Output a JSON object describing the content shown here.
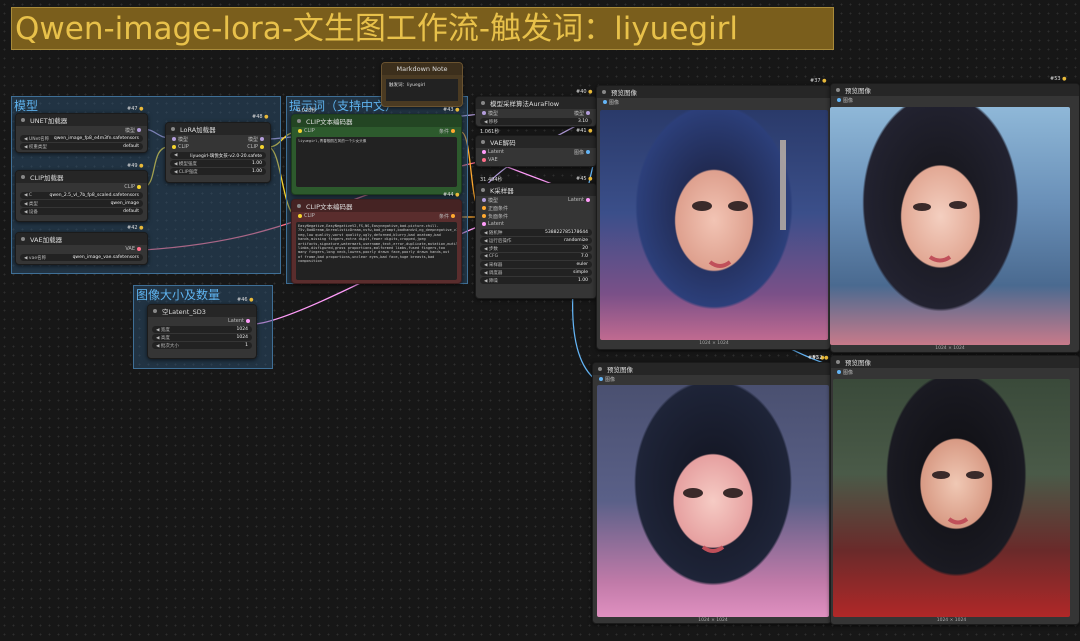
{
  "title": "Qwen-image-lora-文生图工作流-触发词：liyuegirl",
  "groups": {
    "model": "模型",
    "prompt": "提示词（支持中文）",
    "image_size": "图像大小及数量"
  },
  "markdown_note": {
    "title": "Markdown Note",
    "text": "触发词：liyuegirl"
  },
  "unet": {
    "title": "UNET加载器",
    "badge": "#47",
    "out": "模型",
    "unet_label": "UNet名称",
    "unet_value": "qwen_image_fp8_e4m3fn.safetensors",
    "dtype_label": "权重类型",
    "dtype_value": "default"
  },
  "clip_loader": {
    "title": "CLIP加载器",
    "badge": "#49",
    "out": "CLIP",
    "clip_label": "C",
    "clip_value": "qwen_2.5_vl_7b_fp8_scaled.safetensors",
    "type_label": "类型",
    "type_value": "qwen_image",
    "device_label": "设备",
    "device_value": "default"
  },
  "vae_loader": {
    "title": "VAE加载器",
    "badge": "#42",
    "out": "VAE",
    "vae_label": "vae名称",
    "vae_value": "qwen_image_vae.safetensors"
  },
  "lora": {
    "title": "LoRA加载器",
    "badge": "#48",
    "in_model": "模型",
    "in_clip": "CLIP",
    "out_model": "模型",
    "out_clip": "CLIP",
    "lora_value": "liyuegirl-璃悦女孩-v2.0-20.safete",
    "model_strength_label": "模型强度",
    "model_strength": "1.00",
    "clip_strength_label": "CLIP强度",
    "clip_strength": "1.00"
  },
  "clip_pos": {
    "title": "CLIP文本编码器",
    "badge": "#43",
    "time": "0.028秒",
    "in": "CLIP",
    "out": "条件",
    "text": "liyuegirl,青春靓丽古风的一个少女头像"
  },
  "clip_neg": {
    "title": "CLIP文本编码器",
    "badge": "#44",
    "in": "CLIP",
    "out": "条件",
    "text": "EasyNegative,EasyNegativeV2,FS,NS,Easynegative,bad-picture-chill-75v,BadDream,UnrealisticDream,nsfw,bad_prompt,badhandv4,ng_deepnegative_v1_75t,verybadimagenegative_v1.3,badhandv4,bad_prompt_version2,negative_hand-neg,low quality,worst quality,ugly,deformed,blurry,bad anatomy,bad hands,missing fingers,extra digit,fewer digits,cropped,jpeg artifacts,signature,watermark,username,text,error,duplicate,mutation,mutilated,extra limbs,disfigured,gross proportions,malformed limbs,fused fingers,too many fingers,long neck,lowres,poorly drawn face,poorly drawn hands,out of frame,bad proportions,unclear eyes,bad face,huge breasts,bad composition"
  },
  "aura": {
    "title": "模型采样算法AuraFlow",
    "badge": "#40",
    "in": "模型",
    "out": "模型",
    "shift_label": "移移",
    "shift_value": "3.10"
  },
  "vae_decode": {
    "title": "VAE解码",
    "badge": "#41",
    "time": "1.061秒",
    "in_latent": "Latent",
    "in_vae": "VAE",
    "out": "图像"
  },
  "ksampler": {
    "title": "K采样器",
    "badge": "#45",
    "time": "31.494秒",
    "in_model": "模型",
    "in_pos": "正面条件",
    "in_neg": "负面条件",
    "in_latent": "Latent",
    "out": "Latent",
    "seed_label": "随机种",
    "seed_value": "538822785178644",
    "control_label": "运行后操作",
    "control_value": "randomize",
    "steps_label": "步数",
    "steps_value": "20",
    "cfg_label": "CFG",
    "cfg_value": "7.0",
    "sampler_label": "采样器",
    "sampler_value": "euler",
    "scheduler_label": "调度器",
    "scheduler_value": "simple",
    "denoise_label": "降噪",
    "denoise_value": "1.00"
  },
  "latent": {
    "title": "空Latent_SD3",
    "badge": "#46",
    "out": "Latent",
    "width_label": "宽度",
    "width_value": "1024",
    "height_label": "高度",
    "height_value": "1024",
    "batch_label": "批次大小",
    "batch_value": "1"
  },
  "previews": [
    {
      "title": "预览图像",
      "badge": "#37",
      "in": "图像",
      "caption": "1024 × 1024"
    },
    {
      "title": "预览图像",
      "badge": "#53",
      "in": "图像",
      "caption": "1024 × 1024"
    },
    {
      "title": "预览图像",
      "badge": "#51",
      "in": "图像",
      "caption": "1024 × 1024"
    },
    {
      "title": "预览图像",
      "badge": "#52",
      "in": "图像",
      "caption": "1024 × 1024"
    }
  ],
  "colors": {
    "title_bg": "#7a5e1c",
    "title_text": "#e8c14a",
    "group": "#3f6f96",
    "pos_node": "#2d5a2d",
    "neg_node": "#5a2d2d",
    "link_model": "#b39ddb",
    "link_clip": "#f5d42e",
    "link_vae": "#ff6e8a",
    "link_cond": "#ffa930",
    "link_latent": "#ff9cf9",
    "link_image": "#64b5f6"
  }
}
